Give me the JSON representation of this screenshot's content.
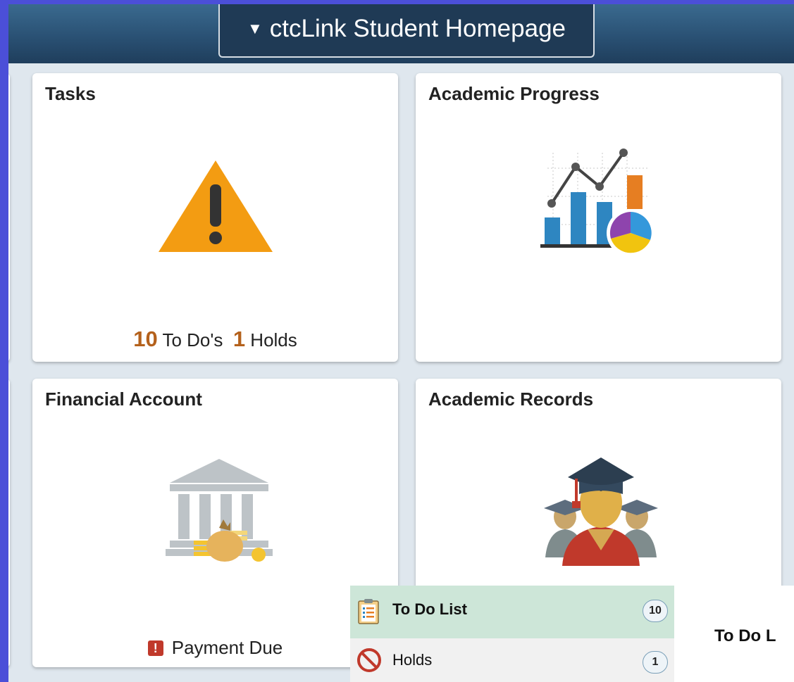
{
  "header": {
    "title": "ctcLink Student Homepage"
  },
  "tiles": {
    "tasks": {
      "title": "Tasks",
      "todo_count": "10",
      "todo_label": "To Do's",
      "holds_count": "1",
      "holds_label": "Holds"
    },
    "academic_progress": {
      "title": "Academic Progress"
    },
    "financial_account": {
      "title": "Financial Account",
      "status": "Payment Due",
      "status_badge": "!"
    },
    "academic_records": {
      "title": "Academic Records"
    }
  },
  "tasks_panel": {
    "items": [
      {
        "label": "To Do List",
        "count": "10",
        "icon": "clipboard-list-icon"
      },
      {
        "label": "Holds",
        "count": "1",
        "icon": "no-entry-icon"
      }
    ],
    "content_title": "To Do L"
  },
  "colors": {
    "accent": "#b4611c",
    "header": "#2a5174",
    "warning": "#f39c12",
    "alert": "#c0392b"
  }
}
